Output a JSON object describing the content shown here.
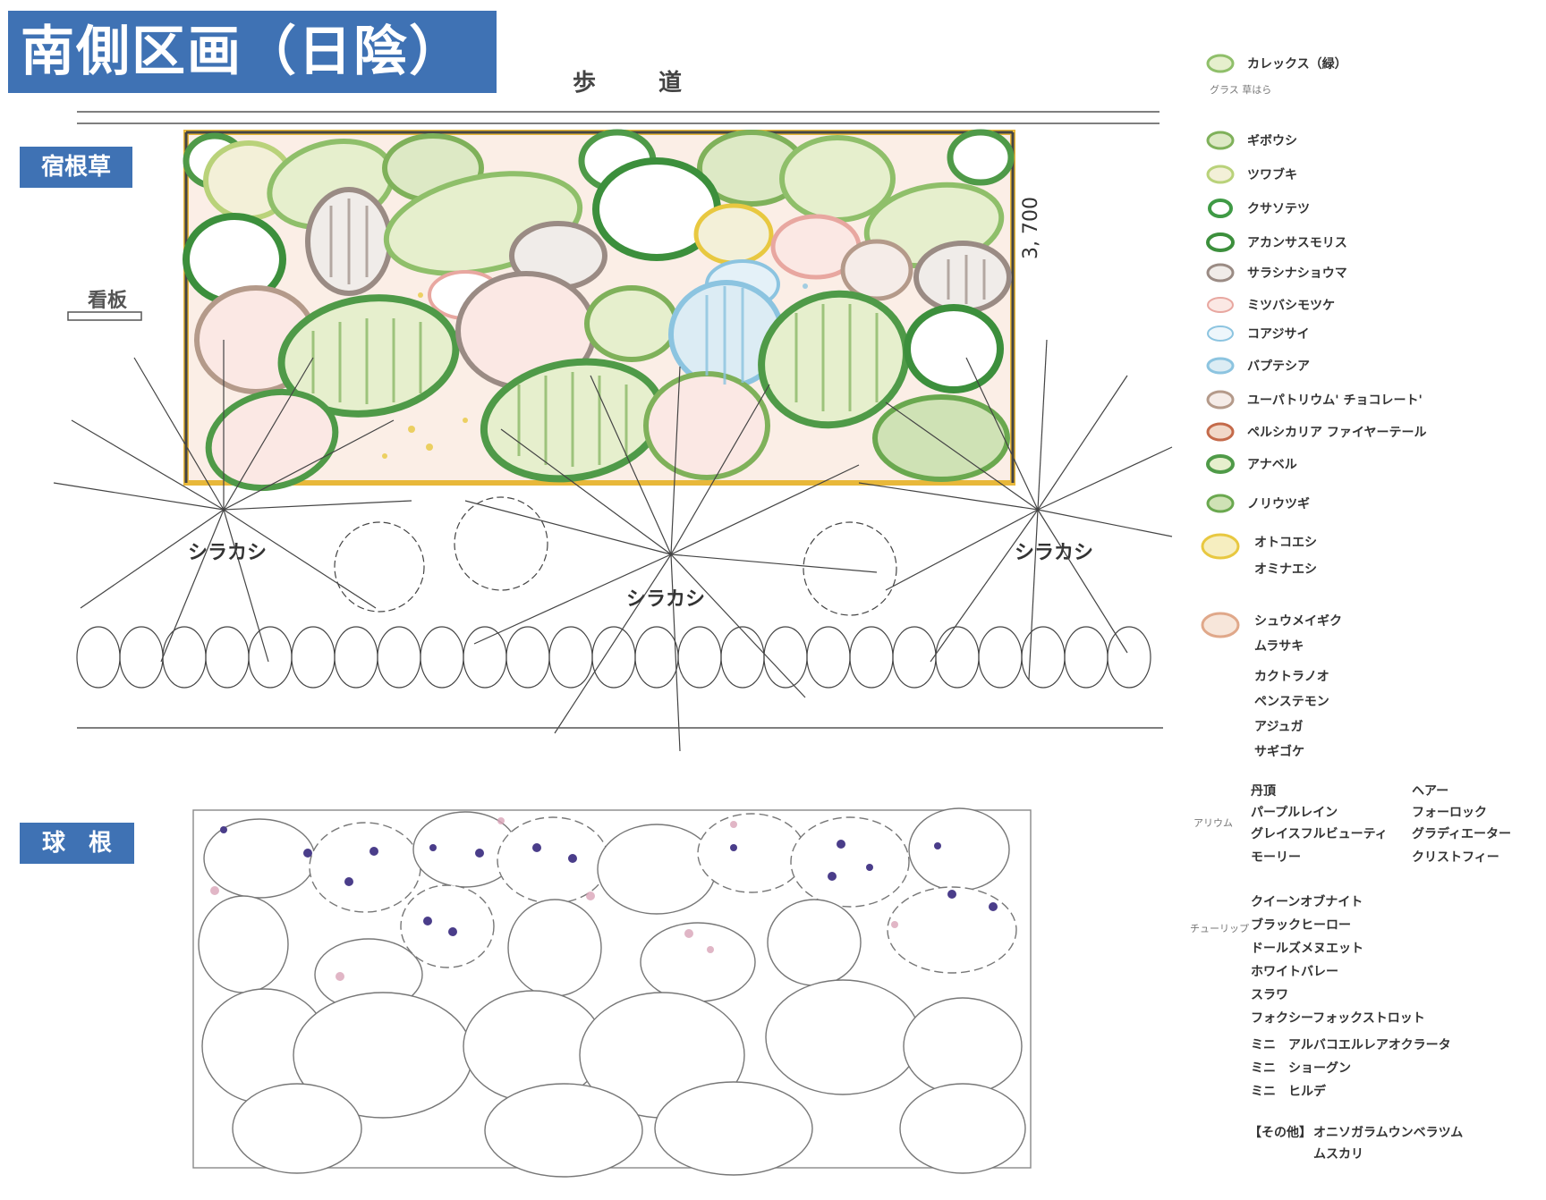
{
  "title": "南側区画（日陰）",
  "sidewalk_label": "歩　道",
  "section_perennial": "宿根草",
  "section_bulb": "球　根",
  "sign_label": "看板",
  "dimension_label": "3, 700",
  "tree_labels": [
    "シラカシ",
    "シラカシ",
    "シラカシ"
  ],
  "legend_perennials": [
    {
      "label": "カレックス（緑）",
      "sublabel": "グラス 草はら",
      "color": "#8fbf6a"
    },
    {
      "label": "ギボウシ",
      "color": "#7fb15a"
    },
    {
      "label": "ツワブキ",
      "color": "#b9d27a"
    },
    {
      "label": "クサソテツ",
      "color": "#3f9a45"
    },
    {
      "label": "アカンサスモリス",
      "color": "#3c8f3c"
    },
    {
      "label": "サラシナショウマ",
      "color": "#9a8b84"
    },
    {
      "label": "ミツバシモツケ",
      "color": "#e8a7a0"
    },
    {
      "label": "コアジサイ",
      "color": "#8cc4e0"
    },
    {
      "label": "バプテシア",
      "color": "#8cc4e0"
    },
    {
      "label": "ユーパトリウム' チョコレート'",
      "color": "#b49a8a"
    },
    {
      "label": "ペルシカリア ファイヤーテール",
      "color": "#c46a4a"
    },
    {
      "label": "アナベル",
      "color": "#4f9a48"
    },
    {
      "label": "ノリウツギ",
      "color": "#6aa84f"
    }
  ],
  "legend_groups": [
    {
      "lines": [
        "オトコエシ",
        "オミナエシ"
      ],
      "color": "#e8c840"
    },
    {
      "lines": [
        "シュウメイギク",
        "ムラサキ",
        "カクトラノオ",
        "ペンステモン",
        "アジュガ",
        "サギゴケ"
      ],
      "color": "#e0a88a"
    }
  ],
  "bulb_col_left": [
    "丹頂",
    "パープルレイン",
    "グレイスフルビューティ",
    "モーリー"
  ],
  "bulb_col_right": [
    "ヘアー",
    "フォーロック",
    "グラディエーター",
    "クリストフィー"
  ],
  "bulb_list": [
    "クイーンオブナイト",
    "ブラックヒーロー",
    "ドールズメヌエット",
    "ホワイトバレー",
    "スラワ",
    "フォクシーフォックストロット",
    "ミニ　アルバコエルレアオクラータ",
    "ミニ　ショーグン",
    "ミニ　ヒルデ"
  ],
  "bulb_other_label": "【その他】",
  "bulb_other": [
    "オニソガラムウンベラツム",
    "ムスカリ"
  ],
  "allium_note": "アリウム",
  "tulip_note": "チューリップ",
  "colors": {
    "accent_blue": "#3f72b4",
    "border_yellow": "#e8b83a",
    "bulb_purple": "#4a3d8a",
    "bulb_pink": "#d9a4b8"
  }
}
